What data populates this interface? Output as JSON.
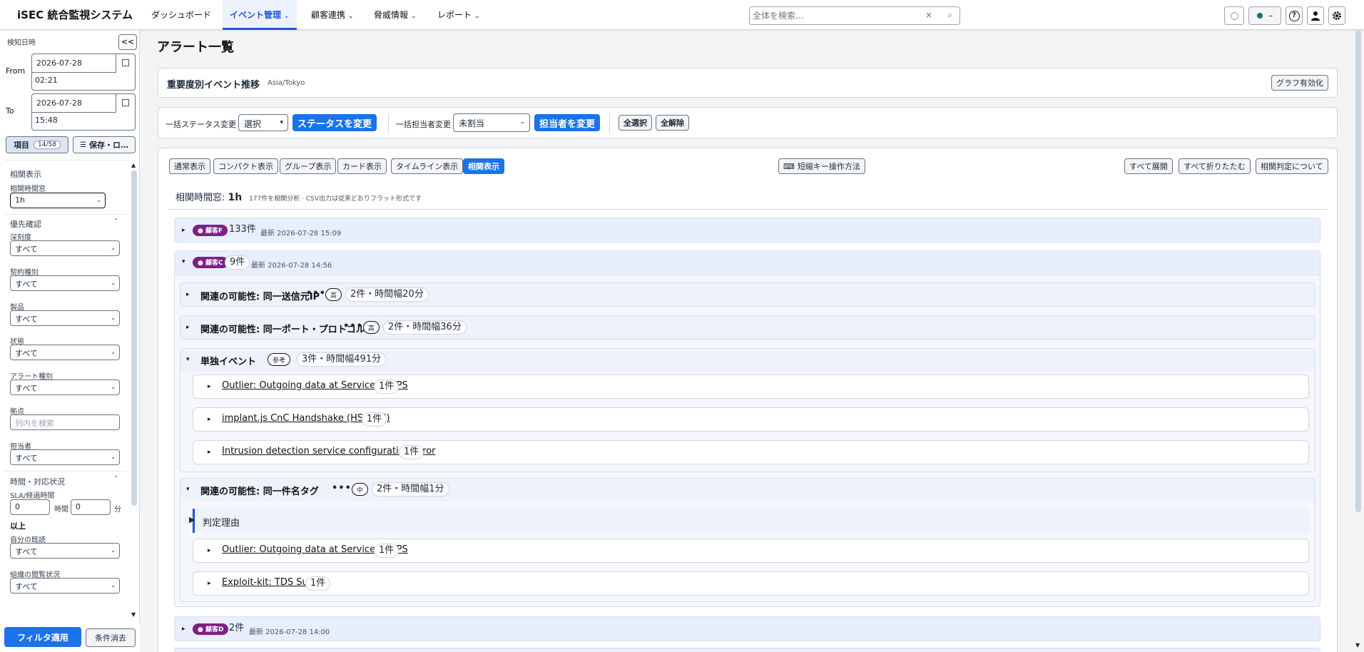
{
  "brand": "iSEC 統合監視システム",
  "nav": {
    "items": [
      {
        "label": "ダッシュボード",
        "chevron": ""
      },
      {
        "label": "イベント管理",
        "chevron": "⌄"
      },
      {
        "label": "顧客連携",
        "chevron": "⌄"
      },
      {
        "label": "脅威情報",
        "chevron": "⌄"
      },
      {
        "label": "レポート",
        "chevron": "⌄"
      }
    ],
    "search_placeholder": "全体を検索…",
    "clear_glyph": "×",
    "search_glyph": "⌕",
    "status_dash": "–",
    "help_glyph": "?"
  },
  "sidebar": {
    "detect_label": "検知日時",
    "collapse_label": "<<",
    "from_label": "From",
    "from_date": "2026-07-28",
    "from_time": "02:21",
    "to_label": "To",
    "to_date": "2026-07-28",
    "to_time": "15:48",
    "items_label": "項目",
    "items_count": "14/58",
    "save_label": "保存・ロ…",
    "display_section": "相関表示",
    "window_label": "相関時間窓",
    "window_value": "1h",
    "priority_section": "優先確認",
    "caret": "ˆ",
    "fields": [
      {
        "label": "深刻度",
        "value": "すべて"
      },
      {
        "label": "契約種別",
        "value": "すべて"
      },
      {
        "label": "製品",
        "value": "すべて"
      },
      {
        "label": "状態",
        "value": "すべて"
      },
      {
        "label": "アラート種別",
        "value": "すべて"
      }
    ],
    "site_label": "拠点",
    "site_placeholder": "列内を検索",
    "owner_label": "担当者",
    "owner_value": "すべて",
    "time_section": "時間・対応状況",
    "sla_label": "SLA/経過時間",
    "sla_hours": "0",
    "sla_hours_unit": "時間",
    "sla_minutes": "0",
    "sla_minutes_unit": "分",
    "sla_suffix": "以上",
    "read_label": "自分の既読",
    "read_value": "すべて",
    "org_read_label": "組織の閲覧状況",
    "org_read_value": "すべて",
    "apply_label": "フィルタ適用",
    "clear_label": "条件消去"
  },
  "main": {
    "title": "アラート一覧",
    "trend_title": "重要度別イベント推移",
    "trend_tz": "Asia/Tokyo",
    "graph_enable": "グラフ有効化",
    "bulk_status_label": "一括ステータス変更",
    "bulk_status_select": "選択",
    "bulk_status_button": "ステータスを変更",
    "bulk_owner_label": "一括担当者変更",
    "bulk_owner_select": "未割当",
    "bulk_owner_button": "担当者を変更",
    "select_all": "全選択",
    "deselect_all": "全解除",
    "view_tabs": [
      "通常表示",
      "コンパクト表示",
      "グループ表示",
      "カード表示",
      "タイムライン表示",
      "相関表示"
    ],
    "shortcut_label": "短縮キー操作方法",
    "expand_all": "すべて展開",
    "collapse_all": "すべて折りたたむ",
    "about_corr": "相関判定について",
    "window_text_prefix": "相関時間窓: ",
    "window_text_value": "1h",
    "window_note": "177件を相関分析 · CSV出力は従来どおりフラット形式です"
  },
  "groups": {
    "g1": {
      "customer": "● 顧客F",
      "count": "133件",
      "latest": "最新 2026-07-28 15:09"
    },
    "g2": {
      "customer": "● 顧客C",
      "count": "9件",
      "latest": "最新 2026-07-28 14:56"
    },
    "g3": {
      "customer": "● 顧客D",
      "count": "2件",
      "latest": "最新 2026-07-28 14:00"
    },
    "sub1": {
      "title": "関連の可能性: 同一送信元IP",
      "dots": "••••",
      "tag": "高",
      "info": "2件・時間幅20分"
    },
    "sub2": {
      "title": "関連の可能性: 同一ポート・プロトコル",
      "dots": "••••",
      "tag": "高",
      "info": "2件・時間幅36分"
    },
    "sub3": {
      "title": "単独イベント",
      "tag": "参考",
      "info": "3件・時間幅491分"
    },
    "sub4": {
      "title": "関連の可能性: 同一件名タグ",
      "dots": "••••",
      "tag": "中",
      "info": "2件・時間幅1分"
    },
    "reason_label": "判定理由",
    "events": [
      {
        "name": "Outlier: Outgoing data at Service HTTPS",
        "count": "1件"
      },
      {
        "name": "implant.js CnC Handshake (HS_SYN)",
        "count": "1件"
      },
      {
        "name": "Intrusion detection service configuration error",
        "count": "1件"
      },
      {
        "name": "Outlier: Outgoing data at Service HTTPS",
        "count": "1件"
      },
      {
        "name": "Exploit-kit: TDS Sutra",
        "count": "1件"
      }
    ]
  },
  "colors": {
    "accent": "#1a73e8",
    "customer_badge": "#7e1f86",
    "group_bg": "#e8eefb"
  }
}
